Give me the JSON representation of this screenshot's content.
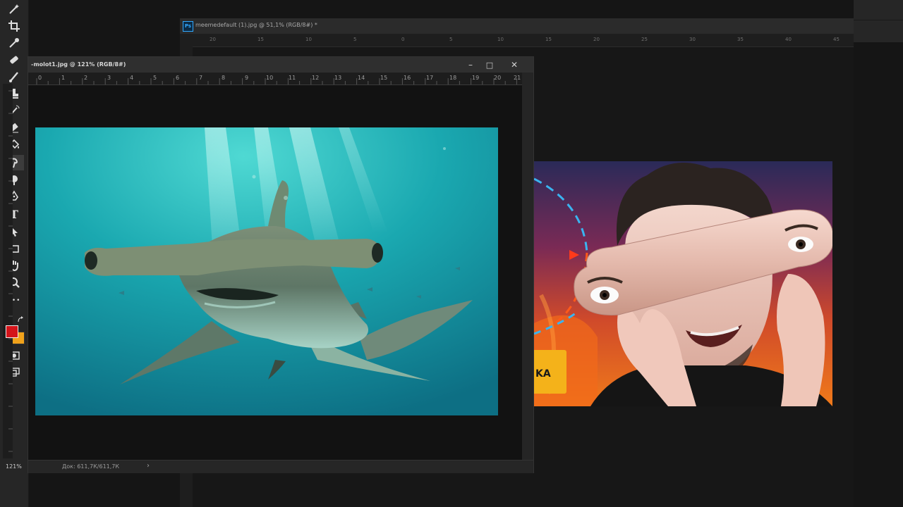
{
  "toolbar": {
    "tools": [
      {
        "icon": "magic-wand-icon"
      },
      {
        "icon": "crop-icon"
      },
      {
        "icon": "eyedropper-icon"
      },
      {
        "icon": "healing-brush-icon"
      },
      {
        "icon": "brush-icon"
      },
      {
        "icon": "clone-stamp-icon"
      },
      {
        "icon": "history-brush-icon"
      },
      {
        "icon": "eraser-icon"
      },
      {
        "icon": "paint-bucket-icon"
      },
      {
        "icon": "smudge-icon"
      },
      {
        "icon": "dodge-icon"
      },
      {
        "icon": "pen-icon"
      },
      {
        "icon": "type-icon",
        "glyph": "T"
      },
      {
        "icon": "path-selection-icon"
      },
      {
        "icon": "rectangle-icon"
      },
      {
        "icon": "hand-icon"
      },
      {
        "icon": "zoom-icon"
      },
      {
        "icon": "more-tools-icon",
        "glyph": "•••"
      }
    ],
    "foreground_color": "#d4141a",
    "background_color": "#f0a21b"
  },
  "doc_back": {
    "title": "meemedefault (1).jpg @ 51,1% (RGB/8#) *",
    "ps_badge": "Ps",
    "ruler_ticks": [
      "20",
      "15",
      "10",
      "5",
      "0",
      "5",
      "10",
      "15",
      "20",
      "25",
      "30",
      "35",
      "40",
      "45"
    ]
  },
  "doc_front": {
    "title": "-molot1.jpg @ 121% (RGB/8#)",
    "minimize": "–",
    "maximize": "□",
    "close": "✕",
    "ruler_ticks": [
      "0",
      "1",
      "2",
      "3",
      "4",
      "5",
      "6",
      "7",
      "8",
      "9",
      "10",
      "11",
      "12",
      "13",
      "14",
      "15",
      "16",
      "17",
      "18",
      "19",
      "20",
      "21"
    ],
    "zoom": "121%",
    "doc_info": "Док: 611,7К/611,7К",
    "status_arrow": "›"
  },
  "person_image": {
    "badge_text": "KA"
  },
  "colors": {
    "accent": "#31a8ff",
    "shark_water": "#1aa8b0"
  }
}
